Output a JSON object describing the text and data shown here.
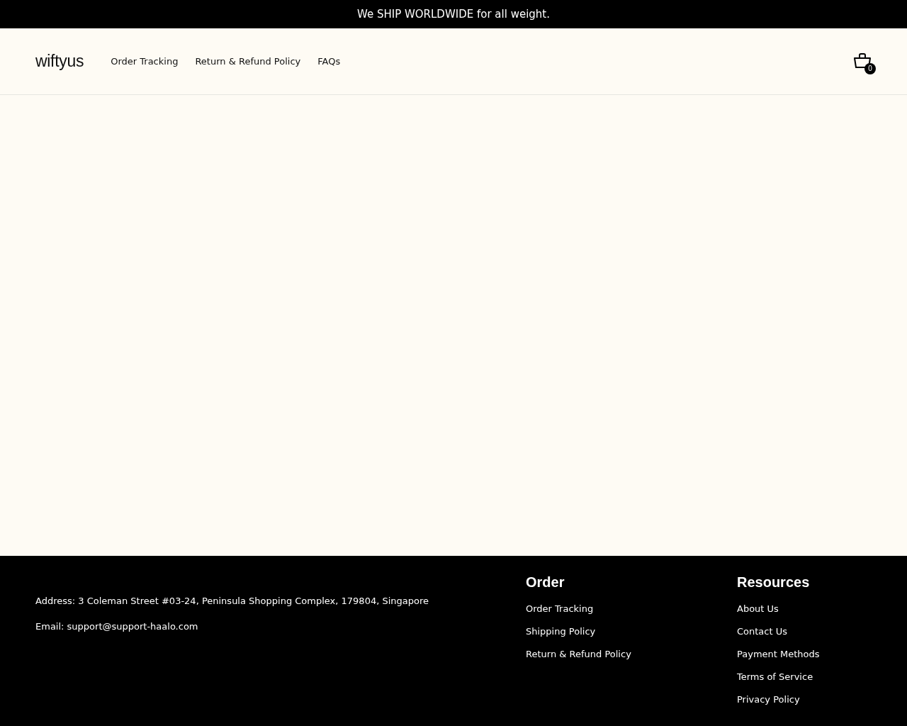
{
  "announcement": "We SHIP WORLDWIDE for all weight.",
  "header": {
    "logo": "wiftyus",
    "nav": [
      {
        "label": "Order Tracking"
      },
      {
        "label": "Return & Refund Policy"
      },
      {
        "label": "FAQs"
      }
    ],
    "cart_count": "0"
  },
  "footer": {
    "contact": [
      "Address: 3 Coleman Street #03-24, Peninsula Shopping Complex, 179804, Singapore",
      "Email: support@support-haalo.com"
    ],
    "columns": [
      {
        "title": "Order",
        "links": [
          "Order Tracking",
          "Shipping Policy",
          "Return & Refund Policy"
        ]
      },
      {
        "title": "Resources",
        "links": [
          "About Us",
          "Contact Us",
          "Payment Methods",
          "Terms of Service",
          "Privacy Policy"
        ]
      }
    ]
  }
}
